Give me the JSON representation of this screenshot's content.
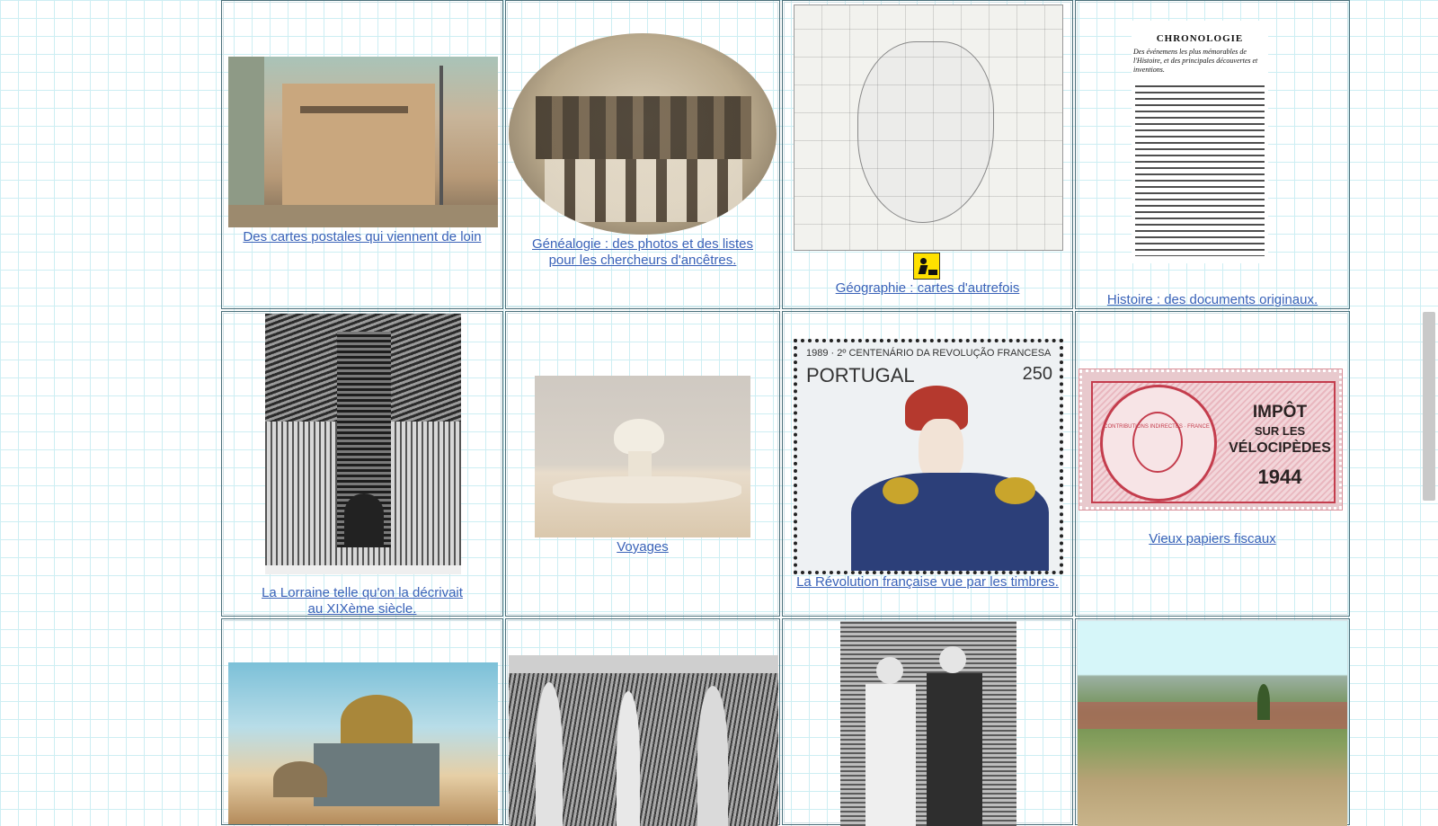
{
  "row1": {
    "c1_caption": "Des cartes postales qui viennent de loin",
    "c2_caption_l1": "Généalogie : des photos et des listes",
    "c2_caption_l2": "pour les chercheurs d'ancêtres.",
    "c3_caption": "Géographie : cartes d'autrefois",
    "c4_caption": "Histoire : des documents originaux."
  },
  "row2": {
    "c1_caption_l1": "La Lorraine telle qu'on la décrivait",
    "c1_caption_l2": "au XIXème siècle.",
    "c2_caption": "Voyages",
    "c3_caption": "La Révolution française vue par les timbres.",
    "c4_caption": "Vieux papiers fiscaux"
  },
  "doc": {
    "title": "CHRONOLOGIE",
    "subtitle": "Des événemens les plus mémorables de l'Histoire, et des principales découvertes et inventions."
  },
  "stamp_pt": {
    "header": "1989 · 2º CENTENÁRIO DA REVOLUÇÃO FRANCESA",
    "country": "PORTUGAL",
    "value": "250"
  },
  "stamp_fr": {
    "ring": "CONTRIBUTIONS INDIRECTES · FRANCE",
    "line1": "IMPÔT",
    "line2": "SUR LES",
    "line3": "VÉLOCIPÈDES",
    "year": "1944"
  },
  "colors": {
    "link": "#3a62b8",
    "grid": "#cdeef3",
    "cell_border": "#4a6f7a"
  },
  "icons": [
    "construction-sign-icon"
  ]
}
